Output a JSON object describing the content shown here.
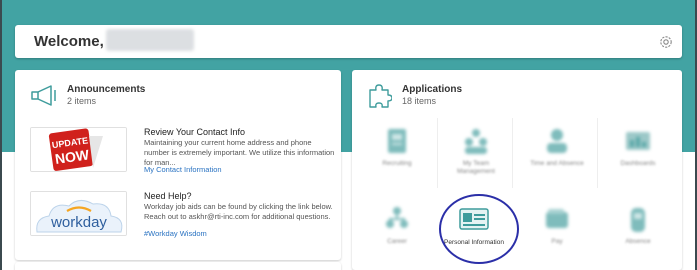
{
  "header": {
    "welcome": "Welcome,",
    "user_name_redacted": ""
  },
  "announcements": {
    "title": "Announcements",
    "count": "2 items",
    "items": [
      {
        "title": "Review Your Contact Info",
        "body": "Maintaining your current home address and phone number is extremely important. We utilize this information for man...",
        "link": "My Contact Information",
        "thumb_text_top": "UPDATE",
        "thumb_text_bottom": "NOW"
      },
      {
        "title": "Need Help?",
        "body": "Workday job aids can be found by clicking the link below. Reach out to askhr@rti-inc.com for additional questions.",
        "link": "#Workday Wisdom",
        "thumb_text": "workday"
      }
    ]
  },
  "applications": {
    "title": "Applications",
    "count": "18 items",
    "tiles": [
      {
        "label": "Recruiting",
        "icon": "clipboard-icon"
      },
      {
        "label": "My Team Management",
        "icon": "team-icon"
      },
      {
        "label": "Time and Absence",
        "icon": "clock-person-icon"
      },
      {
        "label": "Dashboards",
        "icon": "dashboard-icon"
      },
      {
        "label": "Career",
        "icon": "org-chart-icon"
      },
      {
        "label": "Personal Information",
        "icon": "id-card-icon"
      },
      {
        "label": "Pay",
        "icon": "wallet-icon"
      },
      {
        "label": "Absence",
        "icon": "suitcase-icon"
      }
    ]
  },
  "colors": {
    "brand_teal": "#42a3a3",
    "link_blue": "#2a73c2",
    "highlight_circle": "#2b2fa8"
  }
}
